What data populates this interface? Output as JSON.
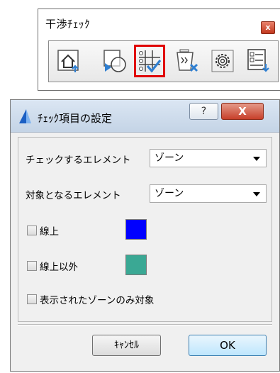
{
  "toolbar": {
    "title": "干渉ﾁｪｯｸ",
    "close_glyph": "x",
    "buttons": [
      {
        "icon": "home-icon"
      },
      {
        "icon": "clash-check-icon"
      },
      {
        "icon": "check-settings-icon",
        "selected": true
      },
      {
        "icon": "clear-results-icon"
      },
      {
        "icon": "gear-icon"
      },
      {
        "icon": "result-list-icon"
      }
    ],
    "highlight_color": "#e00000"
  },
  "dialog": {
    "title": "ﾁｪｯｸ項目の設定",
    "help_glyph": "?",
    "close_glyph": "X",
    "check_element_label": "チェックするエレメント",
    "check_element_value": "ゾーン",
    "target_element_label": "対象となるエレメント",
    "target_element_value": "ゾーン",
    "on_line_label": "線上",
    "on_line_checked": false,
    "on_line_color": "#0000ff",
    "off_line_label": "線上以外",
    "off_line_checked": false,
    "off_line_color": "#3aa894",
    "displayed_only_label": "表示されたゾーンのみ対象",
    "displayed_only_checked": false,
    "cancel_label": "ｷｬﾝｾﾙ",
    "ok_label": "OK"
  }
}
